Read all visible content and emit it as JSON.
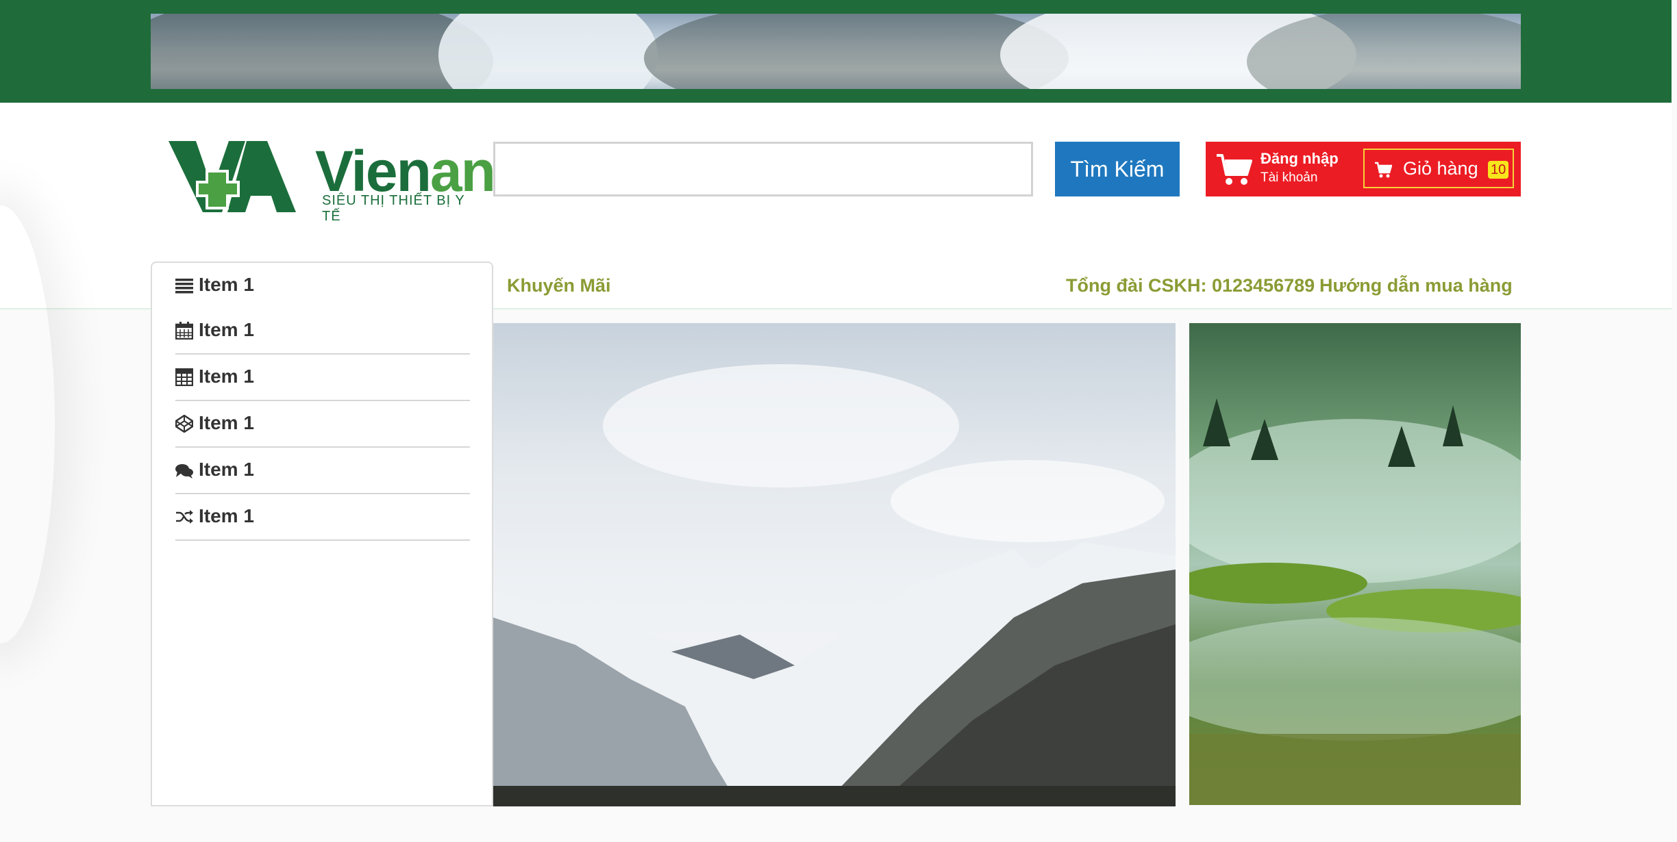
{
  "search": {
    "placeholder": "",
    "button_label": "Tìm Kiếm"
  },
  "brand": {
    "name_dark": "Vien",
    "name_light": "an",
    "tagline": "SIÊU THỊ THIẾT BỊ Y TẾ",
    "primary_color": "#1b6e3b",
    "accent_color": "#4aa043"
  },
  "account": {
    "login_label": "Đăng nhập",
    "account_label": "Tài khoản",
    "cart_label": "Giỏ hàng",
    "cart_count": "10",
    "bg_color": "#ec1c24"
  },
  "nav": {
    "promo": "Khuyến Mãi",
    "hotline": "Tổng đài CSKH: 0123456789",
    "guide": "Hướng dẫn mua hàng",
    "link_color": "#8b9b34"
  },
  "sidebar": {
    "items": [
      {
        "label": "Item 1",
        "icon": "list-icon"
      },
      {
        "label": "Item 1",
        "icon": "calendar-icon"
      },
      {
        "label": "Item 1",
        "icon": "calculator-icon"
      },
      {
        "label": "Item 1",
        "icon": "codepen-icon"
      },
      {
        "label": "Item 1",
        "icon": "comments-icon"
      },
      {
        "label": "Item 1",
        "icon": "random-icon"
      }
    ]
  },
  "search_button_color": "#1f78bf",
  "top_strip_color": "#1f6b3a"
}
